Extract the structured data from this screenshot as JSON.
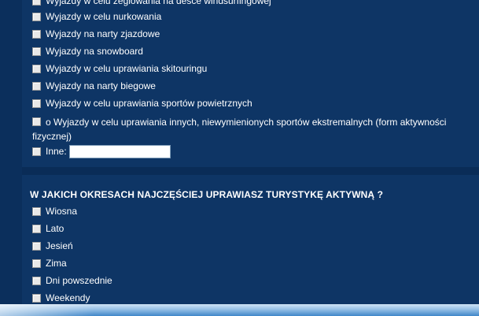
{
  "activity_types": [
    "Wyjazdy w celu żeglowania na desce windsurfingowej",
    "Wyjazdy w celu nurkowania",
    "Wyjazdy na narty zjazdowe",
    "Wyjazdy na snowboard",
    "Wyjazdy w celu uprawiania skitouringu",
    "Wyjazdy na narty biegowe",
    "Wyjazdy w celu uprawiania sportów powietrznych"
  ],
  "extreme_option": "o Wyjazdy w celu uprawiania innych, niewymienionych sportów ekstremalnych (form aktywności fizycznej)",
  "other": {
    "label": "Inne:",
    "value": ""
  },
  "periods_question": "W JAKICH OKRESACH NAJCZĘŚCIEJ UPRAWIASZ TURYSTYKĘ AKTYWNĄ ?",
  "periods": [
    "Wiosna",
    "Lato",
    "Jesień",
    "Zima",
    "Dni powszednie",
    "Weekendy"
  ]
}
